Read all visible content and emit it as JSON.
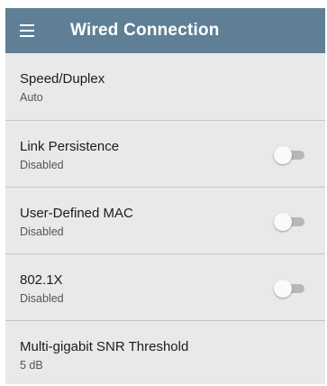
{
  "header": {
    "title": "Wired Connection",
    "menu_icon": "hamburger-menu-icon",
    "background_color": "#5f7f96"
  },
  "settings": [
    {
      "title": "Speed/Duplex",
      "value": "Auto",
      "has_toggle": false
    },
    {
      "title": "Link Persistence",
      "value": "Disabled",
      "has_toggle": true,
      "toggle_on": false
    },
    {
      "title": "User-Defined MAC",
      "value": "Disabled",
      "has_toggle": true,
      "toggle_on": false
    },
    {
      "title": "802.1X",
      "value": "Disabled",
      "has_toggle": true,
      "toggle_on": false
    },
    {
      "title": "Multi-gigabit SNR Threshold",
      "value": "5 dB",
      "has_toggle": false
    }
  ]
}
